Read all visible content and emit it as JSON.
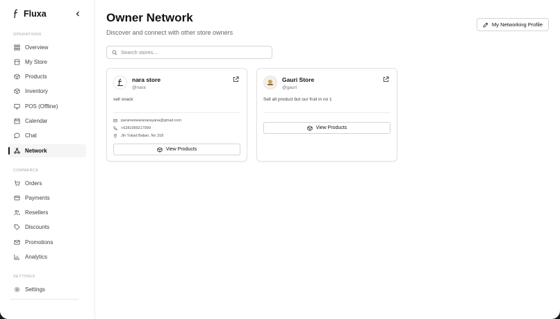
{
  "app": {
    "name": "Fluxa"
  },
  "sidebar": {
    "sections": [
      {
        "label": "OPERATIONS"
      },
      {
        "label": "COMMERCE"
      },
      {
        "label": "SETTINGS"
      }
    ],
    "items": [
      {
        "label": "Overview",
        "icon": "grid-icon"
      },
      {
        "label": "My Store",
        "icon": "store-icon"
      },
      {
        "label": "Products",
        "icon": "package-icon"
      },
      {
        "label": "Inventory",
        "icon": "box-icon"
      },
      {
        "label": "POS (Offline)",
        "icon": "monitor-icon"
      },
      {
        "label": "Calendar",
        "icon": "calendar-icon"
      },
      {
        "label": "Chat",
        "icon": "chat-icon"
      },
      {
        "label": "Network",
        "icon": "network-icon",
        "active": true
      },
      {
        "label": "Orders",
        "icon": "cart-icon"
      },
      {
        "label": "Payments",
        "icon": "credit-card-icon"
      },
      {
        "label": "Resellers",
        "icon": "users-icon"
      },
      {
        "label": "Discounts",
        "icon": "tag-icon"
      },
      {
        "label": "Promotions",
        "icon": "mail-icon"
      },
      {
        "label": "Analytics",
        "icon": "bar-chart-icon"
      },
      {
        "label": "Settings",
        "icon": "gear-icon"
      }
    ]
  },
  "main": {
    "title": "Owner Network",
    "subtitle": "Discover and connect with other store owners",
    "profile_button": "My Networking Profile",
    "search": {
      "placeholder": "Search stores...",
      "value": ""
    },
    "stores": [
      {
        "name": "nara store",
        "handle": "@nara",
        "description": "sell snack",
        "email": "parameswaranarayana@gmail.com",
        "phone": "+6281999217999",
        "address": "Jln Tukad Balian, No 318",
        "button": "View Products"
      },
      {
        "name": "Gauri Store",
        "handle": "@gauri",
        "description": "Sell all product but our fruit in no 1",
        "button": "View Products"
      }
    ]
  },
  "colors": {
    "accent": "#111111",
    "muted": "#a3a3a3",
    "border": "#e2e2e2"
  }
}
